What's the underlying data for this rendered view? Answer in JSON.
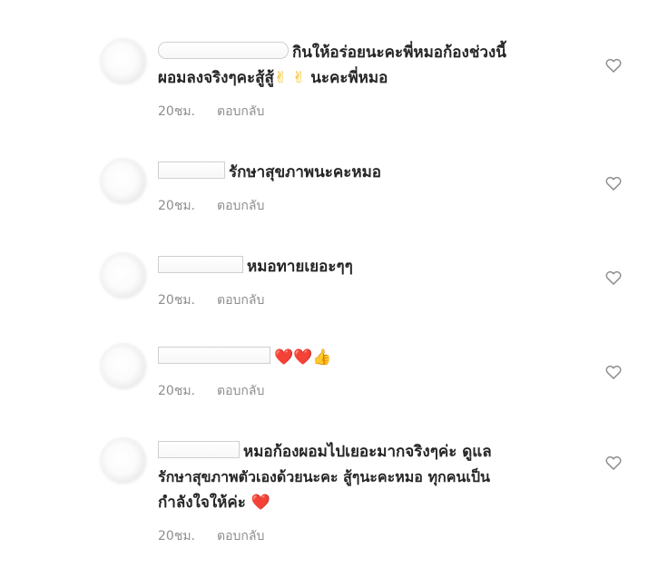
{
  "comments": [
    {
      "text_lines": [
        "กินให้อร่อยนะคะพี่หมอก้องช่วงนี้",
        "ผอมลงจริงๆคะสู้สู้",
        "นะคะพี่หมอ"
      ],
      "emoji_line2": "✌",
      "time": "20ชม.",
      "reply": "ตอบกลับ"
    },
    {
      "text_lines": [
        "รักษาสุขภาพนะคะหมอ"
      ],
      "time": "20ชม.",
      "reply": "ตอบกลับ"
    },
    {
      "text_lines": [
        "หมอทายเยอะๆๆ"
      ],
      "time": "20ชม.",
      "reply": "ตอบกลับ"
    },
    {
      "text_lines": [
        "❤️❤️👍"
      ],
      "time": "20ชม.",
      "reply": "ตอบกลับ"
    },
    {
      "text_lines": [
        "หมอก้องผอมไปเยอะมากจริงๆค่ะ ดูแล",
        "รักษาสุขภาพตัวเองด้วยนะคะ สู้ๆนะคะหมอ ทุกคนเป็น",
        "กำลังใจให้ค่ะ"
      ],
      "emoji_end": "❤️",
      "time": "20ชม.",
      "reply": "ตอบกลับ"
    }
  ],
  "icons": {
    "like": "heart-outline-icon",
    "like_color": "#8e8e8e",
    "heart_emoji_color": "#e8243c"
  }
}
